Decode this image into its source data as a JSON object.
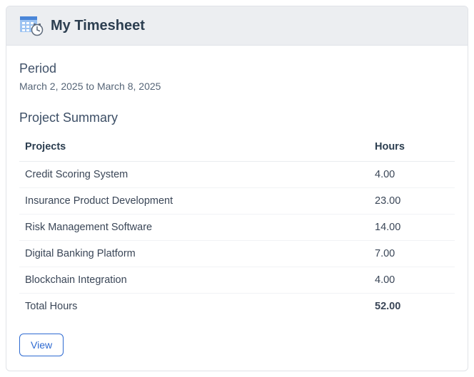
{
  "header": {
    "title": "My Timesheet",
    "icon_name": "timesheet-calendar-clock-icon"
  },
  "period": {
    "label": "Period",
    "range": "March 2, 2025 to March 8, 2025"
  },
  "summary": {
    "title": "Project Summary",
    "columns": {
      "project": "Projects",
      "hours": "Hours"
    },
    "rows": [
      {
        "project": "Credit Scoring System",
        "hours": "4.00"
      },
      {
        "project": "Insurance Product Development",
        "hours": "23.00"
      },
      {
        "project": "Risk Management Software",
        "hours": "14.00"
      },
      {
        "project": "Digital Banking Platform",
        "hours": "7.00"
      },
      {
        "project": "Blockchain Integration",
        "hours": "4.00"
      }
    ],
    "total": {
      "label": "Total Hours",
      "value": "52.00"
    }
  },
  "actions": {
    "view_label": "View"
  },
  "icon_colors": {
    "calendar_light": "#9cc3f2",
    "calendar_dark": "#4a86d8",
    "clock_fill": "#ffffff",
    "clock_stroke": "#5f6b7c"
  }
}
